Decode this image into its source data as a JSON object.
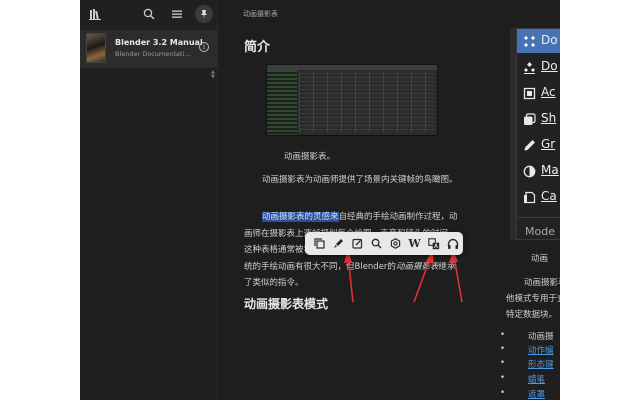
{
  "colors": {
    "background": "#1e1e1e",
    "highlight": "#2a4d9c",
    "link": "#4d9be0",
    "menu_selected": "#4772b3",
    "annotation_arrow": "#e03030"
  },
  "sidebar": {
    "toolbar_icons": [
      "library-icon",
      "search-icon",
      "menu-icon",
      "pin-icon"
    ],
    "book": {
      "title": "Blender 3.2 Manual",
      "subtitle": "Blender Documentation T..."
    }
  },
  "content": {
    "breadcrumb": "动画摄影表",
    "intro_heading": "简介",
    "figure_caption": "动画摄影表。",
    "paragraph1": "动画摄影表为动画师提供了场景内关键帧的鸟瞰图。",
    "paragraph2": {
      "highlight": "动画摄影表的灵感来",
      "part1": "自经典的手绘动画制作过程，动画师在摄影表上逐帧规划每个绘图、声音和镜头的时间，这种表格通常被称为曝光表或“摄影表”。虽然CG基础与传统的手绘动画有很大不同，但Blender的",
      "emphasis": "动画摄影表",
      "part2": "继承了类似的指令。"
    },
    "modes_heading": "动画摄影表模式"
  },
  "mode_menu": {
    "items": [
      {
        "label": "Do",
        "icon": "dope-sheet-icon",
        "selected": true
      },
      {
        "label": "Do",
        "icon": "dope-sheet-icon",
        "selected": false
      },
      {
        "label": "Ac",
        "icon": "action-icon",
        "selected": false
      },
      {
        "label": "Sh",
        "icon": "shape-key-icon",
        "selected": false
      },
      {
        "label": "Gr",
        "icon": "grease-pencil-icon",
        "selected": false
      },
      {
        "label": "Ma",
        "icon": "mask-icon",
        "selected": false
      },
      {
        "label": "Ca",
        "icon": "cache-icon",
        "selected": false
      }
    ],
    "mode_label": "Mode"
  },
  "right_column": {
    "caption": "动画",
    "line1": "动画摄影表模",
    "line2": "他模式专用于查看",
    "line3": "特定数据块。",
    "list": [
      {
        "text": "动画摄",
        "link": false
      },
      {
        "text": "动作编",
        "link": true
      },
      {
        "text": "形态键",
        "link": true
      },
      {
        "text": "蜡笔",
        "link": true
      },
      {
        "text": "遮罩",
        "link": true
      }
    ]
  },
  "float_toolbar": {
    "icons": [
      "copy-icon",
      "highlighter-icon",
      "edit-note-icon",
      "search-icon",
      "openai-icon",
      "wikipedia-icon",
      "translate-icon",
      "headphones-icon"
    ],
    "wiki_glyph": "W"
  }
}
